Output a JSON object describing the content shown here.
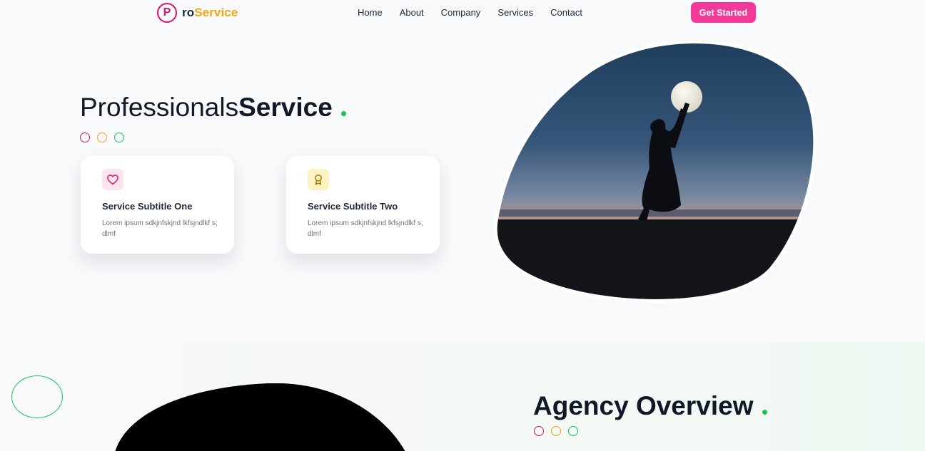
{
  "header": {
    "logo_letter": "P",
    "logo_text_a": "ro",
    "logo_text_b": "Service",
    "nav": [
      "Home",
      "About",
      "Company",
      "Services",
      "Contact"
    ],
    "cta_label": "Get Started"
  },
  "hero": {
    "title_light": "Professionals",
    "title_bold": "Service",
    "cards": [
      {
        "icon": "heart-icon",
        "title": "Service Subtitle One",
        "text": "Lorem ipsum sdkjnfskjnd lkfsjndlkf s;dlmf"
      },
      {
        "icon": "award-icon",
        "title": "Service Subtitle Two",
        "text": "Lorem ipsum sdkjnfskjnd lkfsjndlkf s;dlmf"
      }
    ]
  },
  "overview": {
    "title_light": "Agency ",
    "title_bold": "Overview"
  },
  "colors": {
    "brand_pink": "#d6166c",
    "cta_pink": "#f2399a",
    "brand_orange": "#f2a515",
    "brand_green": "#17c35b",
    "text_dark": "#111827"
  }
}
